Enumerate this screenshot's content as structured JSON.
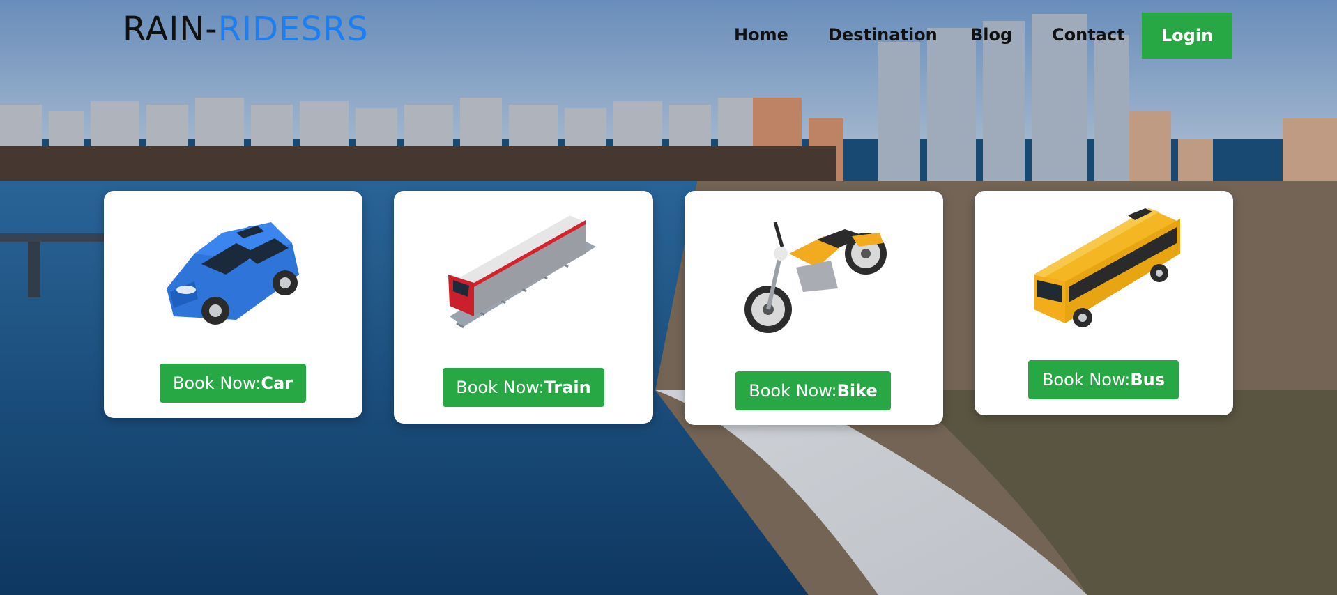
{
  "header": {
    "logo_part1": "RAIN-",
    "logo_part2": "RIDESRS",
    "nav": [
      {
        "label": "Home"
      },
      {
        "label": "Destination"
      },
      {
        "label": "Blog"
      },
      {
        "label": "Contact"
      }
    ],
    "login_label": "Login"
  },
  "cards": [
    {
      "prefix": "Book Now:",
      "vehicle": "Car",
      "icon": "car-icon"
    },
    {
      "prefix": "Book Now:",
      "vehicle": "Train",
      "icon": "train-icon"
    },
    {
      "prefix": "Book Now:",
      "vehicle": "Bike",
      "icon": "motorbike-icon"
    },
    {
      "prefix": "Book Now:",
      "vehicle": "Bus",
      "icon": "bus-icon"
    }
  ],
  "colors": {
    "accent_green": "#28a745",
    "logo_blue": "#1e7ef0",
    "text_dark": "#111111"
  }
}
